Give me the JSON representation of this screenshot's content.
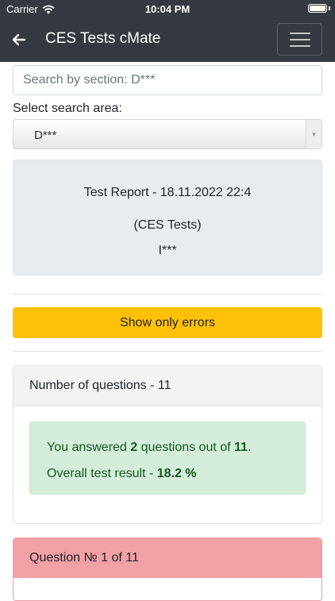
{
  "status_bar": {
    "carrier": "Carrier",
    "time": "10:04 PM"
  },
  "navbar": {
    "title": "CES Tests cMate"
  },
  "search": {
    "placeholder": "Search by section: D***",
    "value": ""
  },
  "search_area": {
    "label": "Select search area:",
    "selected": "D***"
  },
  "report": {
    "title": "Test Report - 18.11.2022 22:4",
    "subtitle": "(CES Tests)",
    "user": "I***"
  },
  "filter": {
    "errors_button_label": "Show only errors"
  },
  "summary": {
    "header": "Number of questions - 11",
    "answered_prefix": "You answered ",
    "answered_count": "2",
    "answered_middle": " questions out of ",
    "total": "11",
    "answered_suffix": ".",
    "result_prefix": "Overall test result - ",
    "result_value": "18.2 %"
  },
  "question": {
    "header": "Question № 1 of 11"
  },
  "colors": {
    "navbar": "#343a40",
    "warning": "#ffc107",
    "success_bg": "#d4edda",
    "success_text": "#155724",
    "danger_header": "#f1a0a5"
  }
}
